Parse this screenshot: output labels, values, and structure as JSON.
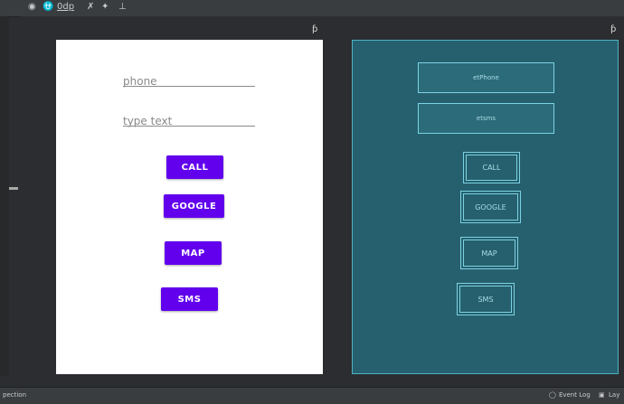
{
  "toolbar": {
    "eye_icon": "eye-icon",
    "magnet_icon": "magnet-icon",
    "margin": "0dp",
    "clear_icon": "clear-constraints-icon",
    "wand_icon": "infer-constraints-icon",
    "guide_icon": "guidelines-icon"
  },
  "design_surface": {
    "phone_placeholder": "phone",
    "text_placeholder": "type text",
    "buttons": [
      "CALL",
      "GOOGLE",
      "MAP",
      "SMS"
    ]
  },
  "blueprint_surface": {
    "labels": [
      "etPhone",
      "etsms"
    ],
    "buttons": [
      "CALL",
      "GOOGLE",
      "MAP",
      "SMS"
    ]
  },
  "colors": {
    "button": "#6200ee",
    "blueprint_bg": "#26606e",
    "canvas_bg": "#2b2d30"
  },
  "statusbar": {
    "left_text": "pection",
    "event_log": "Event Log",
    "layout": "Lay"
  }
}
